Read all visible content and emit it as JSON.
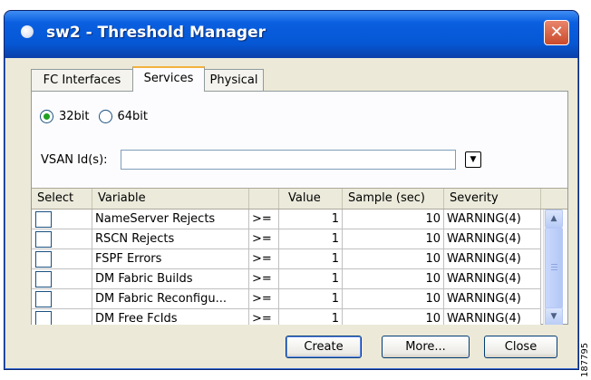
{
  "window": {
    "title": "sw2 - Threshold Manager",
    "close_glyph": "✕"
  },
  "tabs": [
    {
      "label": "FC Interfaces",
      "active": false
    },
    {
      "label": "Services",
      "active": true
    },
    {
      "label": "Physical",
      "active": false
    }
  ],
  "mode": {
    "options": [
      "32bit",
      "64bit"
    ],
    "selected": "32bit"
  },
  "vsan": {
    "label": "VSAN Id(s):",
    "value": "",
    "dropdown_icon": "▼"
  },
  "table": {
    "columns": [
      "Select",
      "Variable",
      "",
      "Value",
      "Sample (sec)",
      "Severity"
    ],
    "rows": [
      {
        "selected": false,
        "variable": "NameServer Rejects",
        "op": ">=",
        "value": "1",
        "sample": "10",
        "severity": "WARNING(4)"
      },
      {
        "selected": false,
        "variable": "RSCN Rejects",
        "op": ">=",
        "value": "1",
        "sample": "10",
        "severity": "WARNING(4)"
      },
      {
        "selected": false,
        "variable": "FSPF Errors",
        "op": ">=",
        "value": "1",
        "sample": "10",
        "severity": "WARNING(4)"
      },
      {
        "selected": false,
        "variable": "DM Fabric Builds",
        "op": ">=",
        "value": "1",
        "sample": "10",
        "severity": "WARNING(4)"
      },
      {
        "selected": false,
        "variable": "DM Fabric Reconfigu...",
        "op": ">=",
        "value": "1",
        "sample": "10",
        "severity": "WARNING(4)"
      },
      {
        "selected": false,
        "variable": "DM Free FcIds",
        "op": ">=",
        "value": "1",
        "sample": "10",
        "severity": "WARNING(4)"
      }
    ],
    "scroll_up_icon": "▲",
    "scroll_down_icon": "▼"
  },
  "buttons": {
    "create": "Create",
    "more": "More...",
    "close": "Close"
  },
  "figure_id": "187795"
}
